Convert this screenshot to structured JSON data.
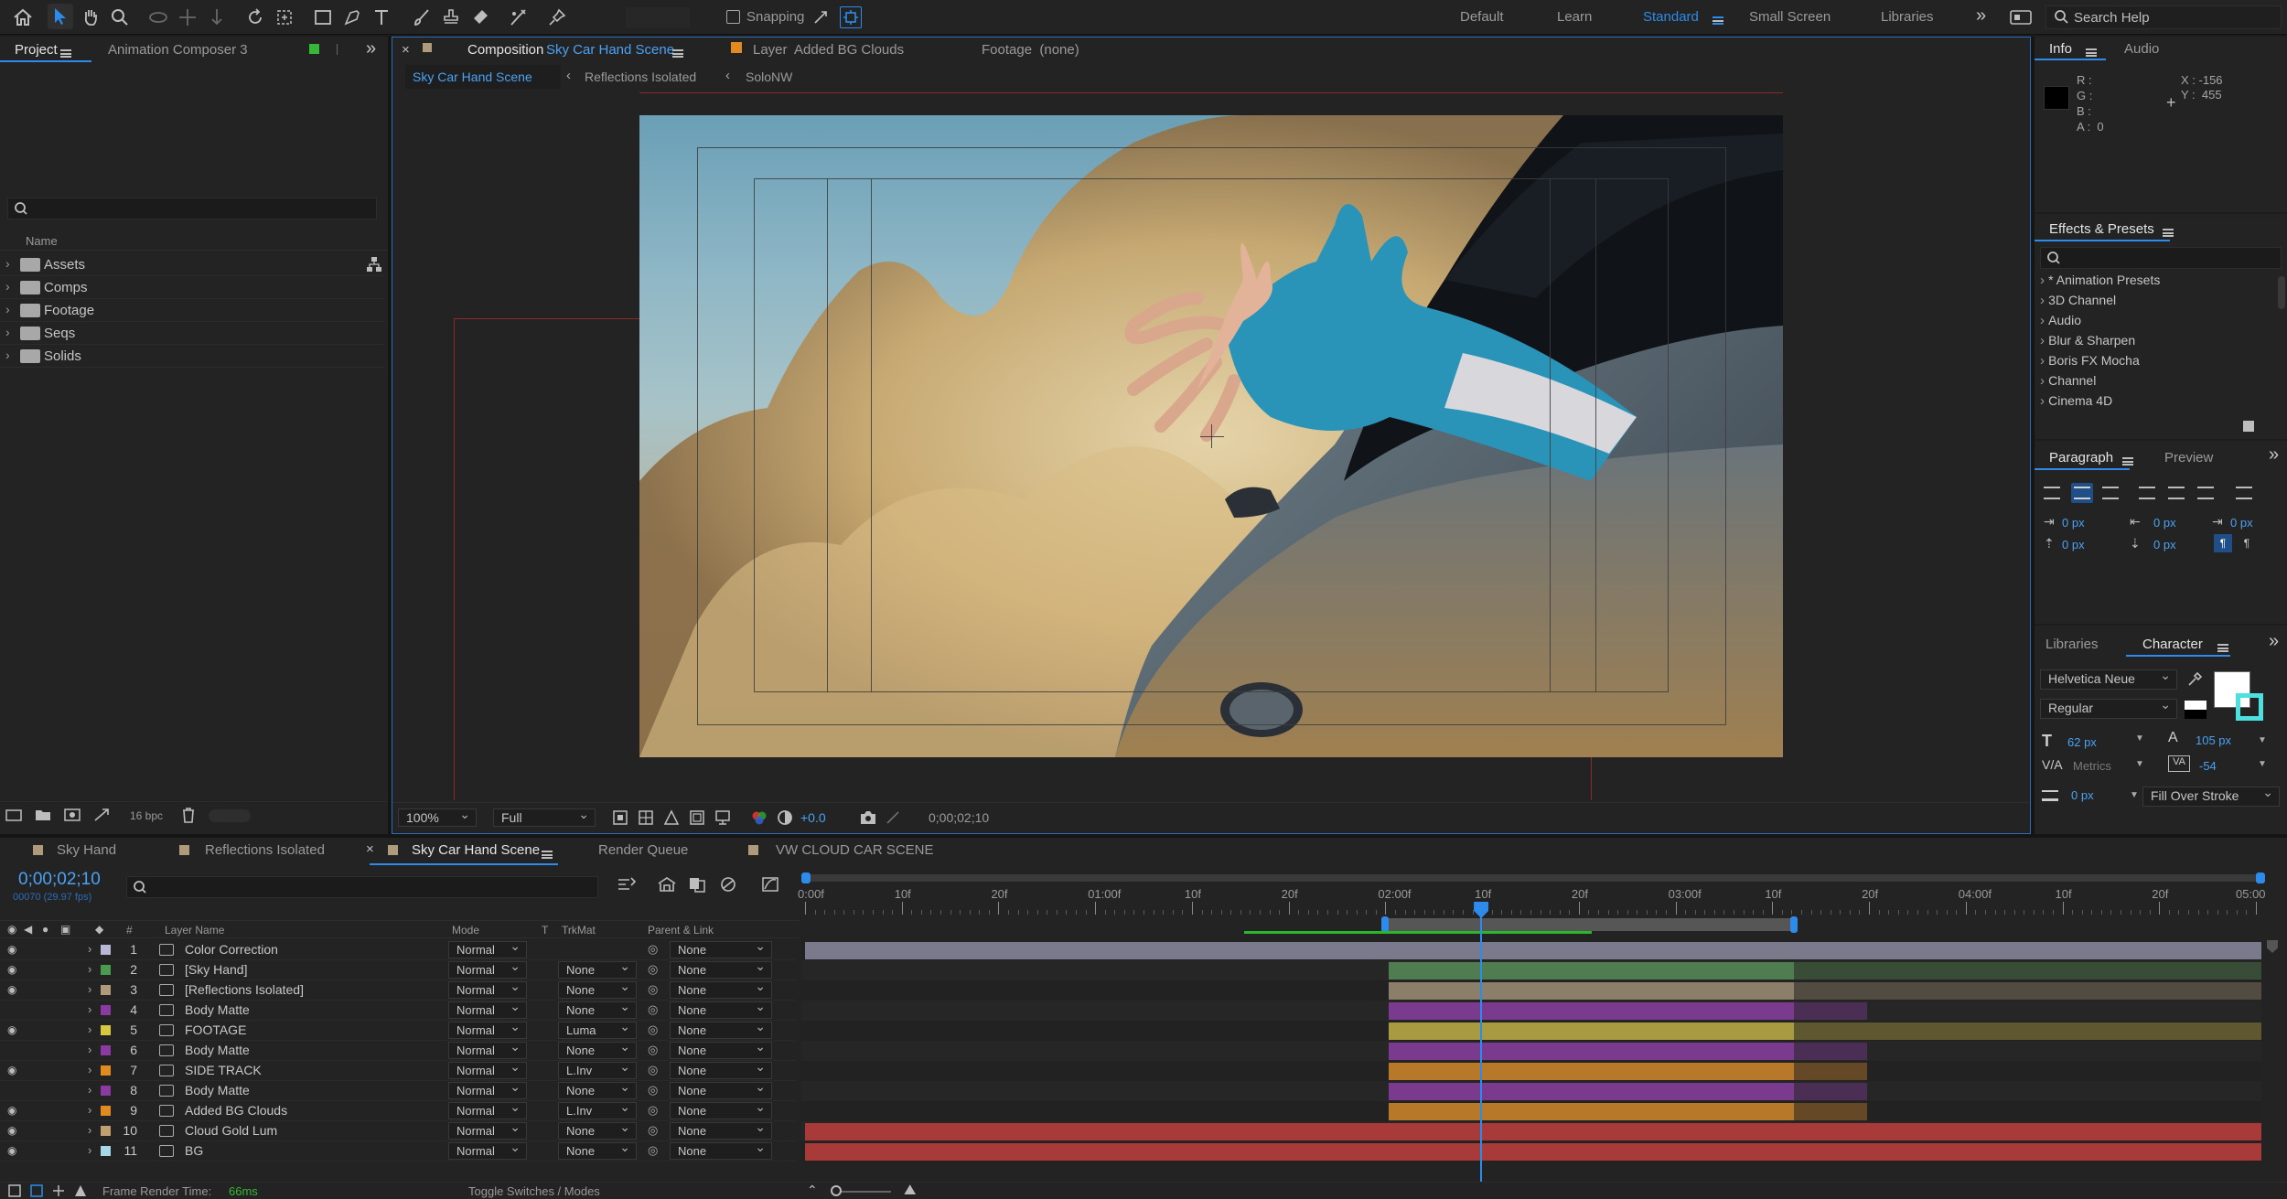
{
  "toolbar": {
    "snapping_label": "Snapping",
    "workspaces": [
      "Default",
      "Learn",
      "Standard",
      "Small Screen",
      "Libraries"
    ],
    "active_workspace": "Standard",
    "search_help_placeholder": "Search Help"
  },
  "project_panel": {
    "tabs": [
      "Project",
      "Animation Composer 3"
    ],
    "name_header": "Name",
    "items": [
      "Assets",
      "Comps",
      "Footage",
      "Seqs",
      "Solids"
    ],
    "bpc": "16 bpc"
  },
  "composition_panel": {
    "tab_prefix": "Composition",
    "tab_name": "Sky Car Hand Scene",
    "layer_tab": "Layer  Added BG Clouds",
    "footage_tab": "Footage  (none)",
    "breadcrumbs": [
      "Sky Car Hand Scene",
      "Reflections Isolated",
      "SoloNW"
    ],
    "zoom": "100%",
    "resolution": "Full",
    "exposure": "+0.0",
    "timecode": "0;00;02;10"
  },
  "info_panel": {
    "tabs": [
      "Info",
      "Audio"
    ],
    "r": "R :",
    "g": "G :",
    "b": "B :",
    "a": "A :  0",
    "x": "X : -156",
    "y": "Y :  455"
  },
  "effects_panel": {
    "title": "Effects & Presets",
    "items": [
      "* Animation Presets",
      "3D Channel",
      "Audio",
      "Blur & Sharpen",
      "Boris FX Mocha",
      "Channel",
      "Cinema 4D"
    ]
  },
  "paragraph_panel": {
    "tabs": [
      "Paragraph",
      "Preview"
    ],
    "values": [
      "0 px",
      "0 px",
      "0 px",
      "0 px",
      "0 px"
    ]
  },
  "character_panel": {
    "tabs": [
      "Libraries",
      "Character"
    ],
    "font": "Helvetica Neue",
    "style": "Regular",
    "size": "62 px",
    "leading": "105 px",
    "kerning": "Metrics",
    "tracking": "-54",
    "stroke": "0 px",
    "stroke_mode": "Fill Over Stroke"
  },
  "timeline": {
    "tabs": [
      "Sky Hand",
      "Reflections Isolated",
      "Sky Car Hand Scene",
      "Render Queue",
      "VW CLOUD CAR SCENE"
    ],
    "active_tab": "Sky Car Hand Scene",
    "timecode": "0;00;02;10",
    "fps": "00070 (29.97 fps)",
    "headers": {
      "num": "#",
      "layer": "Layer Name",
      "mode": "Mode",
      "t": "T",
      "trkmat": "TrkMat",
      "parent": "Parent & Link"
    },
    "ruler": [
      "0:00f",
      "10f",
      "20f",
      "01:00f",
      "10f",
      "20f",
      "02:00f",
      "10f",
      "20f",
      "03:00f",
      "10f",
      "20f",
      "04:00f",
      "10f",
      "20f",
      "05:00"
    ],
    "layers": [
      {
        "num": "1",
        "name": "Color Correction",
        "mode": "Normal",
        "trkmat": "",
        "parent": "None",
        "color": "#b8b6d6",
        "start": 0.0,
        "end": 1.0,
        "bar": "#7a7a8c",
        "tail": 0
      },
      {
        "num": "2",
        "name": "[Sky Hand]",
        "mode": "Normal",
        "trkmat": "None",
        "parent": "None",
        "color": "#4a9a50",
        "start": 0.4,
        "end": 0.68,
        "bar": "#4f7d4f",
        "tail": 1.0
      },
      {
        "num": "3",
        "name": "[Reflections Isolated]",
        "mode": "Normal",
        "trkmat": "None",
        "parent": "None",
        "color": "#b09a7c",
        "start": 0.4,
        "end": 0.68,
        "bar": "#8c7f69",
        "tail": 1.0
      },
      {
        "num": "4",
        "name": "Body Matte",
        "mode": "Normal",
        "trkmat": "None",
        "parent": "None",
        "color": "#8a3aa0",
        "start": 0.4,
        "end": 0.68,
        "bar": "#7a3a8e",
        "tail": 0.73
      },
      {
        "num": "5",
        "name": "FOOTAGE",
        "mode": "Normal",
        "trkmat": "Luma",
        "parent": "None",
        "color": "#d8c840",
        "start": 0.4,
        "end": 0.68,
        "bar": "#a89a40",
        "tail": 1.0
      },
      {
        "num": "6",
        "name": "Body Matte",
        "mode": "Normal",
        "trkmat": "None",
        "parent": "None",
        "color": "#8a3aa0",
        "start": 0.4,
        "end": 0.68,
        "bar": "#7a3a8e",
        "tail": 0.73
      },
      {
        "num": "7",
        "name": "SIDE TRACK",
        "mode": "Normal",
        "trkmat": "L.Inv",
        "parent": "None",
        "color": "#e08a20",
        "start": 0.4,
        "end": 0.68,
        "bar": "#b8782a",
        "tail": 0.73
      },
      {
        "num": "8",
        "name": "Body Matte",
        "mode": "Normal",
        "trkmat": "None",
        "parent": "None",
        "color": "#8a3aa0",
        "start": 0.4,
        "end": 0.68,
        "bar": "#7a3a8e",
        "tail": 0.73
      },
      {
        "num": "9",
        "name": "Added BG Clouds",
        "mode": "Normal",
        "trkmat": "L.Inv",
        "parent": "None",
        "color": "#e08a20",
        "start": 0.4,
        "end": 0.68,
        "bar": "#b8782a",
        "tail": 0.73
      },
      {
        "num": "10",
        "name": "Cloud Gold Lum",
        "mode": "Normal",
        "trkmat": "None",
        "parent": "None",
        "color": "#c0a070",
        "start": 0.0,
        "end": 1.0,
        "bar": "#a83a3a",
        "tail": 0
      },
      {
        "num": "11",
        "name": "BG",
        "mode": "Normal",
        "trkmat": "None",
        "parent": "None",
        "color": "#a8d8e8",
        "start": 0.0,
        "end": 1.0,
        "bar": "#a83a3a",
        "tail": 0
      }
    ],
    "playhead_fraction": 0.465,
    "work_area": [
      0.4,
      0.68
    ],
    "frame_render_label": "Frame Render Time:",
    "frame_render_value": "66ms",
    "toggle_label": "Toggle Switches / Modes"
  }
}
